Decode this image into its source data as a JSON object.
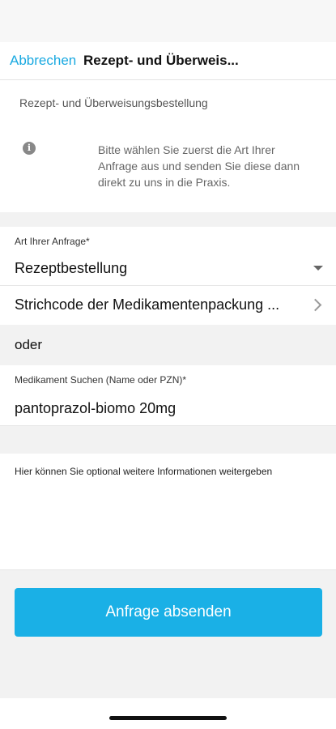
{
  "nav": {
    "cancel_label": "Abbrechen",
    "title": "Rezept- und Überweis..."
  },
  "header": {
    "subtitle": "Rezept- und Überweisungsbestellung",
    "info_icon": "info-icon",
    "info_text": "Bitte wählen Sie zuerst die Art Ihrer Anfrage aus und senden Sie diese dann direkt zu uns in die Praxis."
  },
  "request_type": {
    "label": "Art Ihrer Anfrage*",
    "value": "Rezeptbestellung"
  },
  "barcode_row": {
    "label": "Strichcode der Medikamentenpackung ..."
  },
  "or_label": "oder",
  "medication": {
    "label": "Medikament Suchen (Name oder PZN)*",
    "value": "pantoprazol-biomo 20mg"
  },
  "notes": {
    "placeholder": "Hier können Sie optional weitere Informationen weitergeben"
  },
  "submit_label": "Anfrage absenden",
  "colors": {
    "accent": "#19a9e1",
    "button": "#1ab0e6",
    "band": "#f2f2f2"
  }
}
